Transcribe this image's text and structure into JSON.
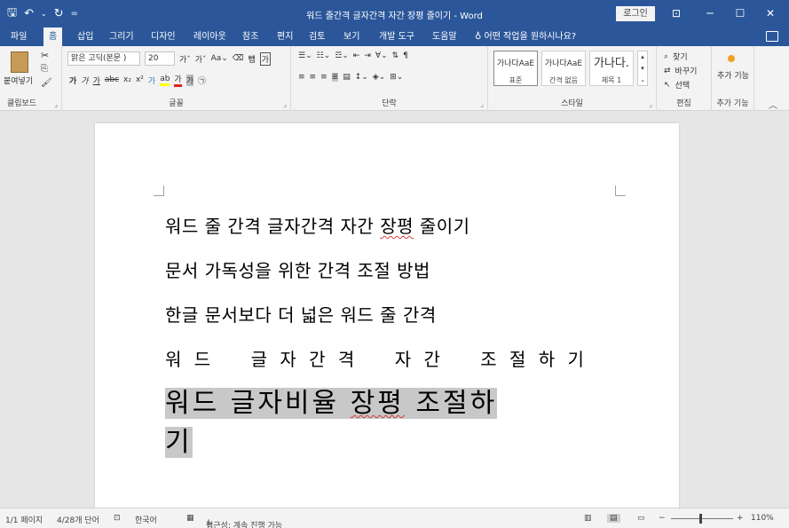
{
  "title_bar": {
    "doc_title": "워드 줄간격 글자간격 자간 장평 줄이기 - Word",
    "login_label": "로그인"
  },
  "tabs": [
    {
      "label": "파일"
    },
    {
      "label": "홈"
    },
    {
      "label": "삽입"
    },
    {
      "label": "그리기"
    },
    {
      "label": "디자인"
    },
    {
      "label": "레이아웃"
    },
    {
      "label": "참조"
    },
    {
      "label": "편지"
    },
    {
      "label": "검토"
    },
    {
      "label": "보기"
    },
    {
      "label": "개발 도구"
    },
    {
      "label": "도움말"
    }
  ],
  "tell_me": "어떤 작업을 원하시나요?",
  "ribbon": {
    "clipboard": {
      "paste_label": "붙여넣기",
      "group_label": "클립보드"
    },
    "font": {
      "font_name": "맑은 고딕(본문 )",
      "font_size": "20",
      "group_label": "글꼴"
    },
    "paragraph": {
      "group_label": "단락"
    },
    "styles": {
      "items": [
        {
          "preview": "가나다AaE",
          "name": "표준"
        },
        {
          "preview": "가나다AaE",
          "name": "간격 없음"
        },
        {
          "preview": "가나다.",
          "name": "제목 1"
        }
      ],
      "group_label": "스타일"
    },
    "editing": {
      "find": "찾기",
      "replace": "바꾸기",
      "select": "선택",
      "group_label": "편집"
    },
    "addins": {
      "label": "추가 기능",
      "group_label": "추가 기능"
    }
  },
  "document": {
    "lines": [
      {
        "text_before": "워드 줄 간격 글자간격 자간 ",
        "text_squiggle": "장평",
        "text_after": " 줄이기"
      },
      {
        "text": "문서 가독성을 위한 간격 조절 방법"
      },
      {
        "text": "한글 문서보다 더 넓은 워드 줄 간격"
      },
      {
        "text": "워 드    글 자 간 격    자 간    조 절 하 기"
      }
    ],
    "highlighted": {
      "part1": "워드 글자비율 ",
      "squiggle": "장평",
      "part2": " 조절하",
      "part3": "기"
    }
  },
  "status_bar": {
    "page": "1/1 페이지",
    "words": "4/28개 단어",
    "language": "한국어",
    "accessibility": "접근성: 계속 진행 가능",
    "zoom": "110%"
  }
}
